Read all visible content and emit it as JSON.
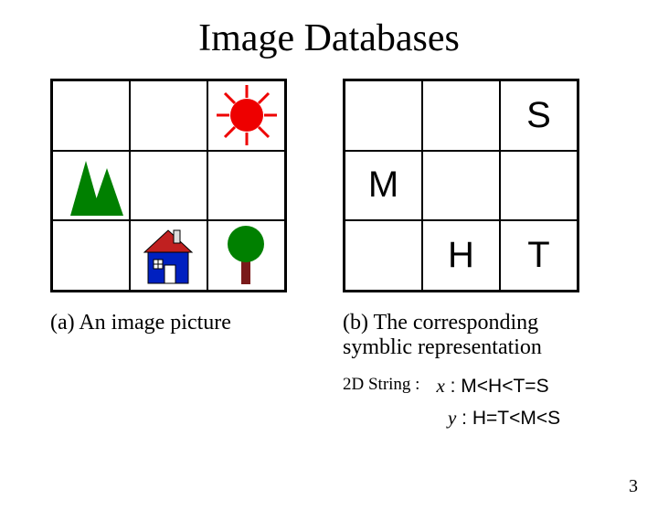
{
  "title": "Image Databases",
  "left": {
    "caption": "(a) An image picture",
    "cells": {
      "sun": "sun-icon",
      "mountain": "mountain-icon",
      "house": "house-icon",
      "tree": "tree-icon"
    }
  },
  "right": {
    "caption": "(b) The corresponding symblic representation",
    "symbols": {
      "r0c2": "S",
      "r1c0": "M",
      "r2c1": "H",
      "r2c2": "T"
    },
    "string_label": "2D String :",
    "x_axis": "x",
    "x_expr": "M<H<T=S",
    "y_axis": "y",
    "y_expr": "H=T<M<S"
  },
  "page_number": "3"
}
